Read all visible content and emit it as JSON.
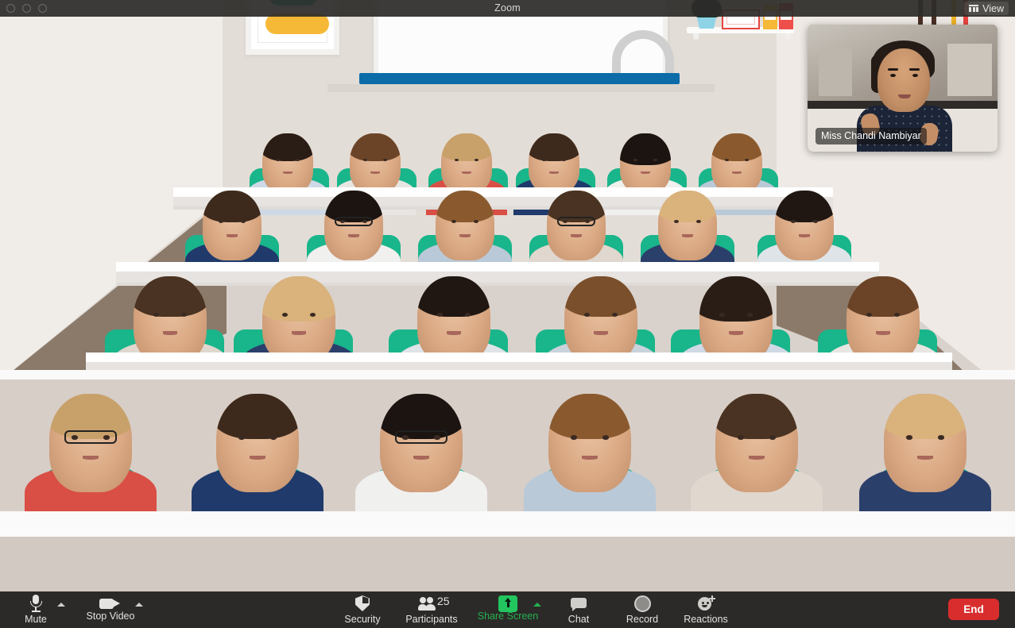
{
  "window": {
    "app_title": "Zoom",
    "traffic_lights": [
      "close",
      "minimize",
      "maximize"
    ],
    "view_button": {
      "label": "View",
      "icon": "grid-icon"
    }
  },
  "self_view": {
    "participant_name": "Miss Chandi Nambiyar"
  },
  "stage": {
    "virtual_background": "classroom",
    "decor": {
      "whiteboard": "whiteboard",
      "poster_frame": "framed-poster",
      "shelf_items": [
        "potted-plant",
        "white-red-box",
        "yellow-book",
        "red-book"
      ]
    },
    "rows": [
      {
        "name": "back-row",
        "seat_count": 6
      },
      {
        "name": "middle-row",
        "seat_count": 6
      },
      {
        "name": "third-row",
        "seat_count": 6
      },
      {
        "name": "front-row",
        "seat_count": 6
      }
    ]
  },
  "toolbar": {
    "background": "#2b2a28",
    "accent_green": "#25b04f",
    "end_color": "#d92d2d",
    "items": [
      {
        "id": "mute",
        "label": "Mute",
        "icon": "microphone-icon",
        "has_chevron": true,
        "green": false
      },
      {
        "id": "stop-video",
        "label": "Stop Video",
        "icon": "video-camera-icon",
        "has_chevron": true,
        "green": false
      },
      {
        "id": "security",
        "label": "Security",
        "icon": "shield-icon",
        "has_chevron": false,
        "green": false
      },
      {
        "id": "participants",
        "label": "Participants",
        "icon": "people-icon",
        "has_chevron": false,
        "green": false,
        "count": "25"
      },
      {
        "id": "share-screen",
        "label": "Share Screen",
        "icon": "share-screen-icon",
        "has_chevron": true,
        "green": true
      },
      {
        "id": "chat",
        "label": "Chat",
        "icon": "chat-bubble-icon",
        "has_chevron": false,
        "green": false
      },
      {
        "id": "record",
        "label": "Record",
        "icon": "record-icon",
        "has_chevron": false,
        "green": false
      },
      {
        "id": "reactions",
        "label": "Reactions",
        "icon": "reactions-icon",
        "has_chevron": false,
        "green": false
      }
    ],
    "end_button": {
      "label": "End"
    }
  }
}
